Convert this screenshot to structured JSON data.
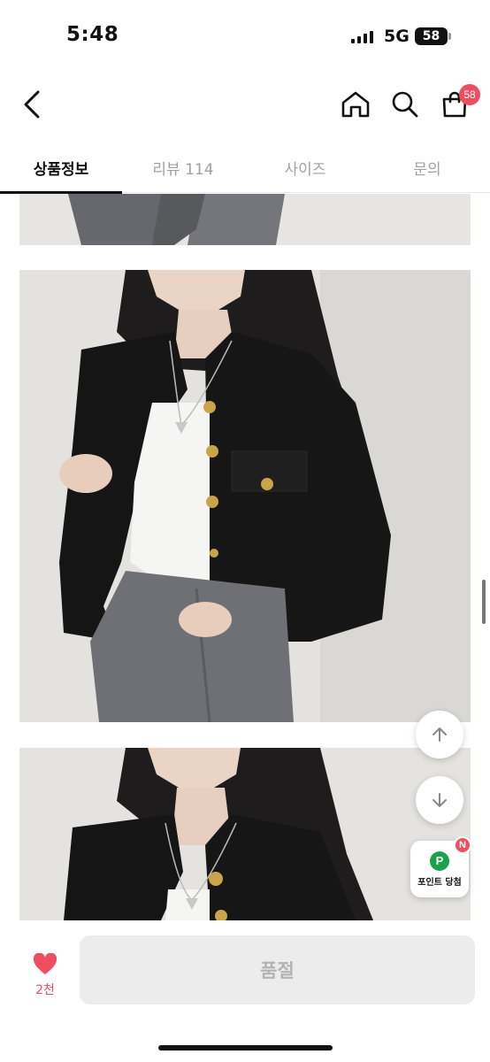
{
  "status_bar": {
    "time": "5:48",
    "network": "5G",
    "battery": "58"
  },
  "header": {
    "back_icon": "chevron-left-icon",
    "home_icon": "home-icon",
    "search_icon": "search-icon",
    "cart_icon": "shopping-bag-icon",
    "cart_count": "58"
  },
  "tabs": [
    {
      "label": "상품정보",
      "active": true
    },
    {
      "label": "리뷰 114",
      "active": false
    },
    {
      "label": "사이즈",
      "active": false
    },
    {
      "label": "문의",
      "active": false
    }
  ],
  "floating": {
    "scroll_up_icon": "arrow-up-icon",
    "scroll_down_icon": "arrow-down-icon",
    "point_icon_text": "P",
    "point_label": "포인트 당첨",
    "point_badge": "N"
  },
  "bottom_bar": {
    "like_icon": "heart-icon",
    "like_count": "2천",
    "soldout_label": "품절"
  },
  "colors": {
    "accent": "#ee4e60",
    "point_green": "#17a34a",
    "disabled_bg": "#ececec",
    "disabled_text": "#b3b3b3"
  }
}
